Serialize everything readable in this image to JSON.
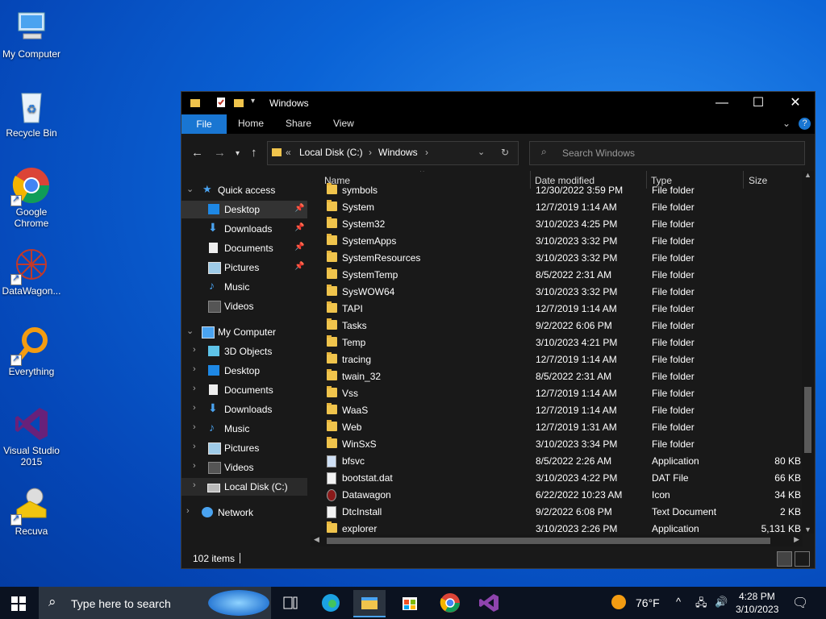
{
  "desktop": {
    "icons": [
      {
        "label": "My Computer"
      },
      {
        "label": "Recycle Bin"
      },
      {
        "label": "Google Chrome"
      },
      {
        "label": "DataWagon..."
      },
      {
        "label": "Everything"
      },
      {
        "label": "Visual Studio 2015"
      },
      {
        "label": "Recuva"
      }
    ]
  },
  "window": {
    "title": "Windows",
    "ribbon": {
      "file": "File",
      "home": "Home",
      "share": "Share",
      "view": "View"
    },
    "address": {
      "root": "Local Disk (C:)",
      "folder": "Windows",
      "sep1": "«",
      "sep2": "›",
      "sep3": "›"
    },
    "search_placeholder": "Search Windows",
    "nav": {
      "quick_access": "Quick access",
      "quick_items": [
        "Desktop",
        "Downloads",
        "Documents",
        "Pictures",
        "Music",
        "Videos"
      ],
      "my_computer": "My Computer",
      "computer_items": [
        "3D Objects",
        "Desktop",
        "Documents",
        "Downloads",
        "Music",
        "Pictures",
        "Videos",
        "Local Disk (C:)"
      ],
      "network": "Network"
    },
    "columns": {
      "name": "Name",
      "date": "Date modified",
      "type": "Type",
      "size": "Size"
    },
    "files": [
      {
        "name": "symbols",
        "date": "12/30/2022 3:59 PM",
        "type": "File folder",
        "size": "",
        "kind": "folder"
      },
      {
        "name": "System",
        "date": "12/7/2019 1:14 AM",
        "type": "File folder",
        "size": "",
        "kind": "folder"
      },
      {
        "name": "System32",
        "date": "3/10/2023 4:25 PM",
        "type": "File folder",
        "size": "",
        "kind": "folder"
      },
      {
        "name": "SystemApps",
        "date": "3/10/2023 3:32 PM",
        "type": "File folder",
        "size": "",
        "kind": "folder"
      },
      {
        "name": "SystemResources",
        "date": "3/10/2023 3:32 PM",
        "type": "File folder",
        "size": "",
        "kind": "folder"
      },
      {
        "name": "SystemTemp",
        "date": "8/5/2022 2:31 AM",
        "type": "File folder",
        "size": "",
        "kind": "folder"
      },
      {
        "name": "SysWOW64",
        "date": "3/10/2023 3:32 PM",
        "type": "File folder",
        "size": "",
        "kind": "folder"
      },
      {
        "name": "TAPI",
        "date": "12/7/2019 1:14 AM",
        "type": "File folder",
        "size": "",
        "kind": "folder"
      },
      {
        "name": "Tasks",
        "date": "9/2/2022 6:06 PM",
        "type": "File folder",
        "size": "",
        "kind": "folder"
      },
      {
        "name": "Temp",
        "date": "3/10/2023 4:21 PM",
        "type": "File folder",
        "size": "",
        "kind": "folder"
      },
      {
        "name": "tracing",
        "date": "12/7/2019 1:14 AM",
        "type": "File folder",
        "size": "",
        "kind": "folder"
      },
      {
        "name": "twain_32",
        "date": "8/5/2022 2:31 AM",
        "type": "File folder",
        "size": "",
        "kind": "folder"
      },
      {
        "name": "Vss",
        "date": "12/7/2019 1:14 AM",
        "type": "File folder",
        "size": "",
        "kind": "folder"
      },
      {
        "name": "WaaS",
        "date": "12/7/2019 1:14 AM",
        "type": "File folder",
        "size": "",
        "kind": "folder"
      },
      {
        "name": "Web",
        "date": "12/7/2019 1:31 AM",
        "type": "File folder",
        "size": "",
        "kind": "folder"
      },
      {
        "name": "WinSxS",
        "date": "3/10/2023 3:34 PM",
        "type": "File folder",
        "size": "",
        "kind": "folder"
      },
      {
        "name": "bfsvc",
        "date": "8/5/2022 2:26 AM",
        "type": "Application",
        "size": "80 KB",
        "kind": "app"
      },
      {
        "name": "bootstat.dat",
        "date": "3/10/2023 4:22 PM",
        "type": "DAT File",
        "size": "66 KB",
        "kind": "file"
      },
      {
        "name": "Datawagon",
        "date": "6/22/2022 10:23 AM",
        "type": "Icon",
        "size": "34 KB",
        "kind": "icon"
      },
      {
        "name": "DtcInstall",
        "date": "9/2/2022 6:08 PM",
        "type": "Text Document",
        "size": "2 KB",
        "kind": "file"
      },
      {
        "name": "explorer",
        "date": "3/10/2023 2:26 PM",
        "type": "Application",
        "size": "5,131 KB",
        "kind": "folderapp"
      }
    ],
    "status": "102 items"
  },
  "taskbar": {
    "search_placeholder": "Type here to search",
    "weather": "76°F",
    "time": "4:28 PM",
    "date": "3/10/2023"
  }
}
